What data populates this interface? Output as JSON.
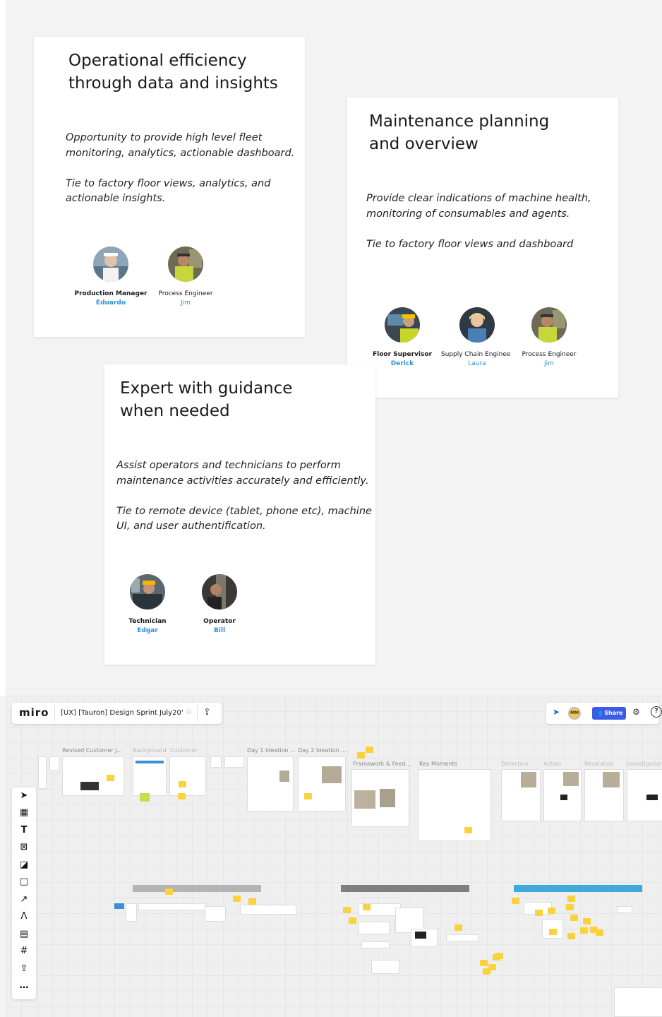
{
  "cards": [
    {
      "title_lines": [
        "Operational efficiency",
        "through data and insights"
      ],
      "body_lines": [
        "Opportunity to provide high level fleet",
        "monitoring, analytics, actionable dashboard.",
        "",
        "Tie to factory floor views, analytics, and",
        "actionable insights."
      ],
      "personas": [
        {
          "role": "Production Manager",
          "name": "Eduardo",
          "bold": true
        },
        {
          "role": "Process Engineer",
          "name": "Jim",
          "bold": false
        }
      ]
    },
    {
      "title_lines": [
        "Maintenance planning",
        "and overview"
      ],
      "body_lines": [
        "Provide clear indications of machine health,",
        "monitoring of consumables and agents.",
        "",
        "Tie to factory floor views and dashboard"
      ],
      "personas": [
        {
          "role": "Floor Supervisor",
          "name": "Derick",
          "bold": true
        },
        {
          "role": "Supply Chain Engineer",
          "name": "Laura",
          "bold": false
        },
        {
          "role": "Process Engineer",
          "name": "Jim",
          "bold": false
        }
      ]
    },
    {
      "title_lines": [
        "Expert with guidance",
        "when needed"
      ],
      "body_lines": [
        "Assist operators and technicians to perform",
        "maintenance activities accurately and efficiently.",
        "",
        "Tie to remote device (tablet, phone etc), machine",
        "UI, and user authentification."
      ],
      "personas": [
        {
          "role": "Technician",
          "name": "Edgar",
          "bold": true
        },
        {
          "role": "Operator",
          "name": "Bill",
          "bold": true
        }
      ]
    }
  ],
  "miro": {
    "logo": "miro",
    "board_title": "[UX] [Tauron] Design Sprint July20'",
    "avatar_initials": "MM",
    "share_label": "Share",
    "icons": {
      "star": "star-icon",
      "export": "upload-icon",
      "cursor": "cursor-icon",
      "settings": "sliders-icon",
      "help": "help-icon"
    },
    "frame_labels": [
      "Revised Customer J...",
      "Background",
      "Customer",
      "Day 1 Ideation ...",
      "Day 2 Ideation ...",
      "Framework & Feed...",
      "Key Moments",
      "Detection",
      "Action",
      "Resolution",
      "Investigation"
    ],
    "toolbar_tools": [
      "select-tool",
      "templates-tool",
      "text-tool",
      "frame-x-tool",
      "sticky-note-tool",
      "shape-tool",
      "arrow-tool",
      "pen-tool",
      "comment-tool",
      "frame-tool",
      "upload-tool",
      "more-tool"
    ],
    "accent": "#3d5ce6",
    "sticky_color": "#fbd23b"
  }
}
